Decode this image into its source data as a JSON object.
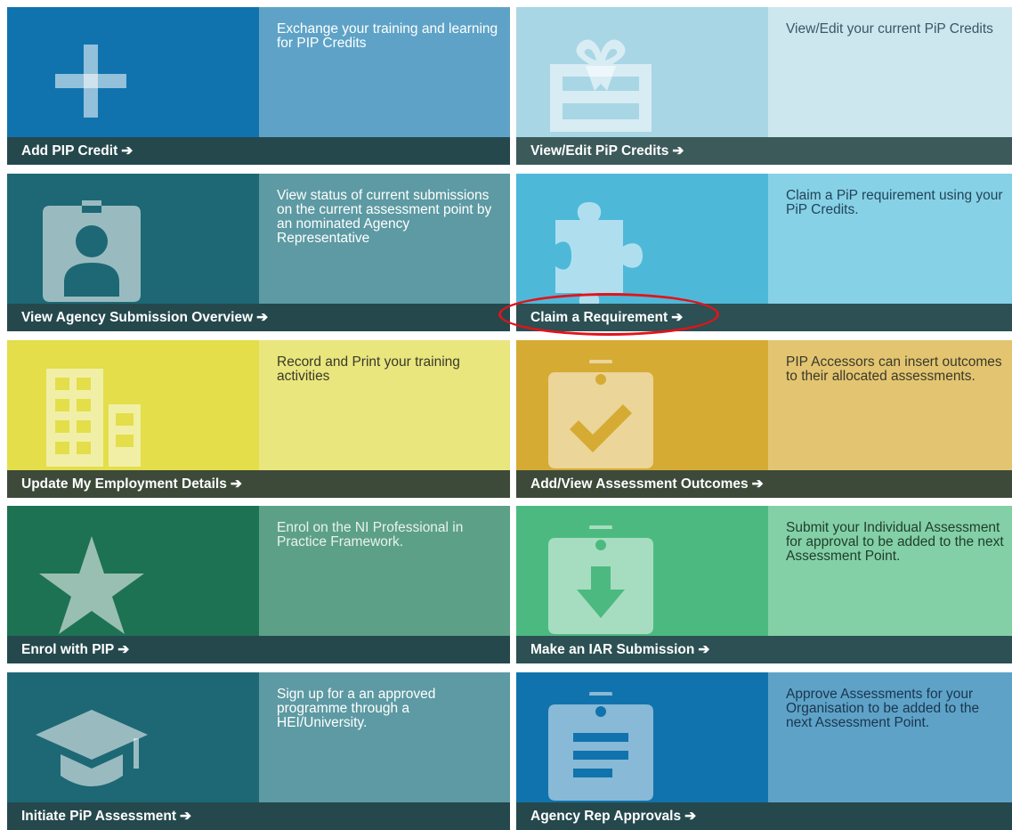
{
  "tiles": [
    {
      "id": "add-pip-credit",
      "label": "Add PIP Credit",
      "arrow": "➔",
      "description": "Exchange your training and learning for PIP Credits",
      "icon": "plus-icon",
      "colors": {
        "left": "#1173ad",
        "right": "#5ea3c7",
        "bar": "#25484d",
        "text": "#ffffff"
      }
    },
    {
      "id": "view-edit-pip-credits",
      "label": "View/Edit PiP Credits",
      "arrow": "➔",
      "description": "View/Edit your current PiP Credits",
      "icon": "gift-card-icon",
      "colors": {
        "left": "#a8d6e4",
        "right": "#cde7ef",
        "bar": "#3d5a5b",
        "text": "#3d5566"
      }
    },
    {
      "id": "view-agency-submission-overview",
      "label": "View Agency Submission Overview",
      "arrow": "➔",
      "description": "View status of current submissions on the current assessment point by an nominated Agency Representative",
      "icon": "id-badge-icon",
      "colors": {
        "left": "#1d6874",
        "right": "#5d9aa3",
        "bar": "#25484d",
        "text": "#ffffff"
      }
    },
    {
      "id": "claim-a-requirement",
      "label": "Claim a Requirement",
      "arrow": "➔",
      "description": "Claim a PiP requirement using your PiP Credits.",
      "icon": "puzzle-piece-icon",
      "colors": {
        "left": "#4eb8d9",
        "right": "#87d1e6",
        "bar": "#2c5053",
        "text": "#20455a"
      }
    },
    {
      "id": "update-my-employment-details",
      "label": "Update My Employment Details",
      "arrow": "➔",
      "description": "Record and Print your training activities",
      "icon": "building-icon",
      "colors": {
        "left": "#e3de4a",
        "right": "#e9e67e",
        "bar": "#3d4a3a",
        "text": "#3a3a2a"
      }
    },
    {
      "id": "add-view-assessment-outcomes",
      "label": "Add/View Assessment Outcomes",
      "arrow": "➔",
      "description": "PIP Accessors can insert outcomes to their allocated assessments.",
      "icon": "clipboard-check-icon",
      "colors": {
        "left": "#d6ab33",
        "right": "#e3c571",
        "bar": "#3d4a3a",
        "text": "#3a3a2a"
      }
    },
    {
      "id": "enrol-with-pip",
      "label": "Enrol with PIP",
      "arrow": "➔",
      "description": "Enrol on the NI Professional in Practice Framework.",
      "icon": "star-icon",
      "colors": {
        "left": "#1d7254",
        "right": "#5da088",
        "bar": "#25484d",
        "text": "#e8f2ee"
      }
    },
    {
      "id": "make-an-iar-submission",
      "label": "Make an IAR Submission",
      "arrow": "➔",
      "description": "Submit your Individual Assessment for approval to be added to the next Assessment Point.",
      "icon": "clipboard-download-icon",
      "colors": {
        "left": "#4cba80",
        "right": "#84d0a6",
        "bar": "#2c5053",
        "text": "#1e3d2d"
      }
    },
    {
      "id": "initiate-pip-assessment",
      "label": "Initiate PiP Assessment",
      "arrow": "➔",
      "description": "Sign up for a an approved programme through a HEI/University.",
      "icon": "graduation-cap-icon",
      "colors": {
        "left": "#1d6874",
        "right": "#5d9aa3",
        "bar": "#25484d",
        "text": "#ffffff"
      }
    },
    {
      "id": "agency-rep-approvals",
      "label": "Agency Rep Approvals",
      "arrow": "➔",
      "description": "Approve Assessments for your Organisation to be added to the next Assessment Point.",
      "icon": "clipboard-list-icon",
      "colors": {
        "left": "#1173ad",
        "right": "#5ea3c7",
        "bar": "#25484d",
        "text": "#1a3550"
      }
    }
  ],
  "highlight": {
    "target": "claim-a-requirement",
    "color": "#e0141b"
  }
}
